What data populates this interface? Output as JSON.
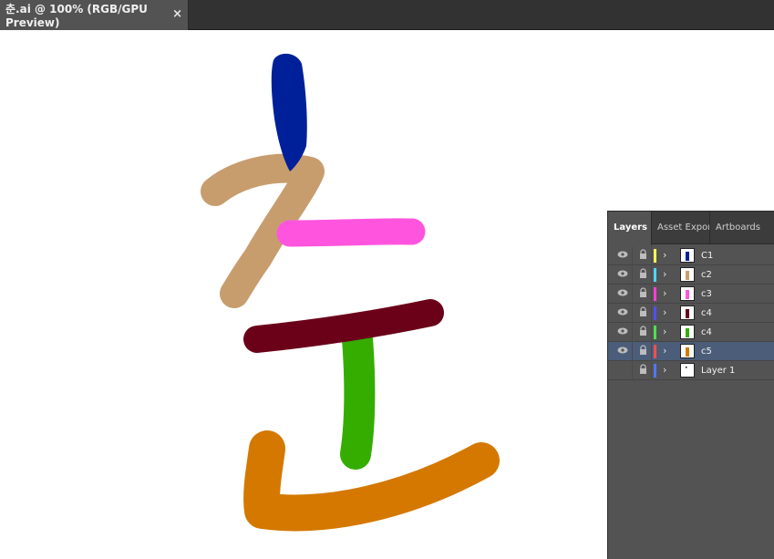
{
  "document_tab": {
    "title": "춘.ai @ 100% (RGB/GPU Preview)",
    "close_glyph": "×"
  },
  "artwork": {
    "strokes": [
      {
        "name": "c1-stroke",
        "color": "#00209a"
      },
      {
        "name": "c2-stroke",
        "color": "#c89d6e"
      },
      {
        "name": "c3-stroke",
        "color": "#ff55de"
      },
      {
        "name": "c4-stroke",
        "color": "#6b0019"
      },
      {
        "name": "c4b-stroke",
        "color": "#34ad00"
      },
      {
        "name": "c5-stroke",
        "color": "#d47800"
      }
    ]
  },
  "layers_panel": {
    "tabs": [
      "Layers",
      "Asset Expor",
      "Artboards"
    ],
    "active_tab": "Layers",
    "layers": [
      {
        "name": "C1",
        "color": "#ffff58",
        "visible": true,
        "selected": false,
        "thumb_color": "#00209a"
      },
      {
        "name": "c2",
        "color": "#4ed8ff",
        "visible": true,
        "selected": false,
        "thumb_color": "#c89d6e"
      },
      {
        "name": "c3",
        "color": "#ff3ed8",
        "visible": true,
        "selected": false,
        "thumb_color": "#ff55de"
      },
      {
        "name": "c4",
        "color": "#4f4fff",
        "visible": true,
        "selected": false,
        "thumb_color": "#6b0019"
      },
      {
        "name": "c4",
        "color": "#4ee04e",
        "visible": true,
        "selected": false,
        "thumb_color": "#34ad00"
      },
      {
        "name": "c5",
        "color": "#ff4e4e",
        "visible": true,
        "selected": true,
        "thumb_color": "#d47800"
      },
      {
        "name": "Layer 1",
        "color": "#4f78ff",
        "visible": false,
        "selected": false,
        "thumb_color": "#000000"
      }
    ]
  }
}
